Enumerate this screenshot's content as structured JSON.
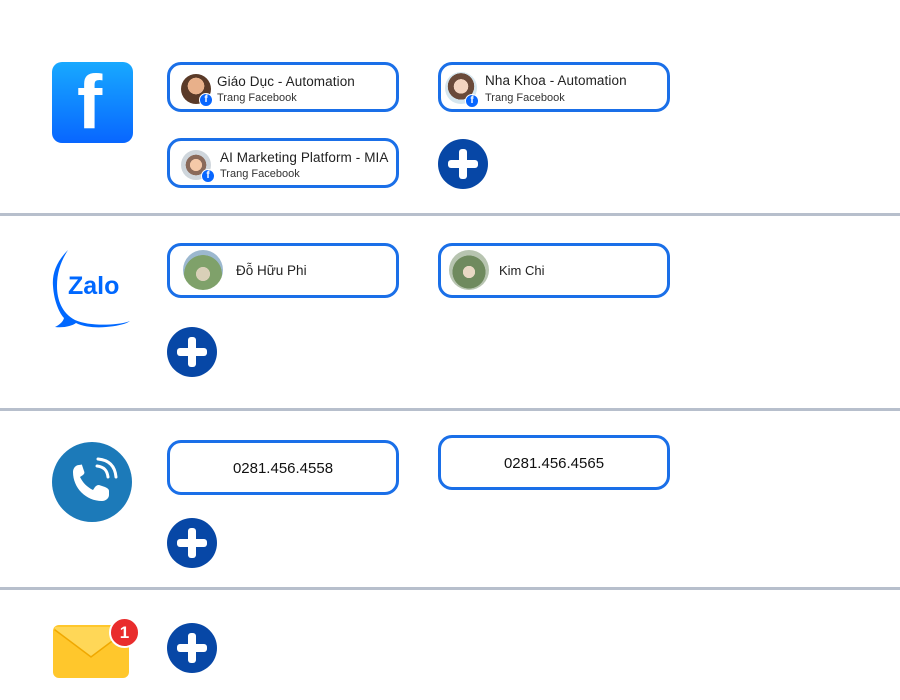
{
  "colors": {
    "pill_border": "#1a6fe8",
    "add_button": "#0747a6",
    "facebook": "#0866ff",
    "zalo": "#0068ff",
    "phone": "#1c7ab9",
    "mail": "#ffc72c",
    "badge": "#e92d2d",
    "divider": "#b7bfcc"
  },
  "facebook": {
    "icon": "facebook-icon",
    "pages": [
      {
        "title": "Giáo Dục - Automation",
        "subtitle": "Trang Facebook"
      },
      {
        "title": "Nha Khoa - Automation",
        "subtitle": "Trang Facebook"
      },
      {
        "title": "AI Marketing Platform - MIA",
        "subtitle": "Trang Facebook"
      }
    ]
  },
  "zalo": {
    "icon": "zalo-icon",
    "logo_text": "Zalo",
    "accounts": [
      {
        "name": "Đỗ Hữu Phi"
      },
      {
        "name": "Kim Chi"
      }
    ]
  },
  "phone": {
    "icon": "phone-icon",
    "numbers": [
      "0281.456.4558",
      "0281.456.4565"
    ]
  },
  "email": {
    "icon": "mail-icon",
    "badge_count": "1"
  }
}
